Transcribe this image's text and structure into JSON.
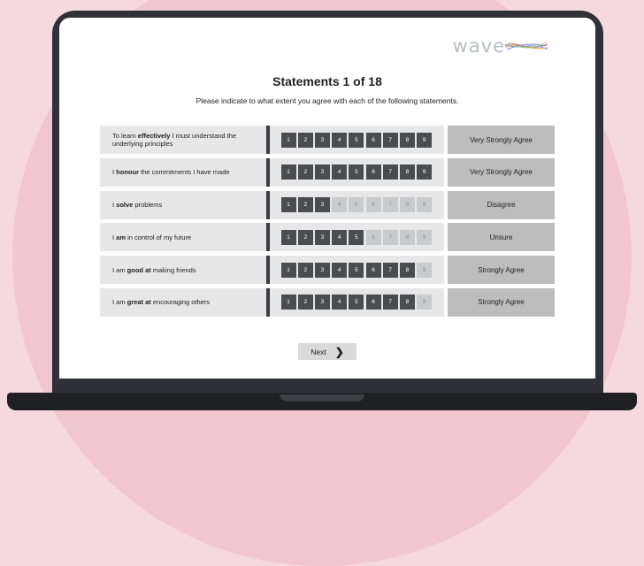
{
  "brand": {
    "logo_text": "wave"
  },
  "header": {
    "title": "Statements 1 of 18",
    "subtitle": "Please indicate to what extent you agree with each of the following statements."
  },
  "scale": {
    "labels": [
      "1",
      "2",
      "3",
      "4",
      "5",
      "6",
      "7",
      "8",
      "9"
    ]
  },
  "statements": [
    {
      "segments": [
        {
          "t": "To learn ",
          "b": false
        },
        {
          "t": "effectively",
          "b": true
        },
        {
          "t": " I must understand the underlying principles",
          "b": false
        }
      ],
      "selected": 9,
      "answer": "Very Strongly Agree"
    },
    {
      "segments": [
        {
          "t": "I ",
          "b": false
        },
        {
          "t": "honour",
          "b": true
        },
        {
          "t": " the commitments I have made",
          "b": false
        }
      ],
      "selected": 9,
      "answer": "Very Strongly Agree"
    },
    {
      "segments": [
        {
          "t": "I ",
          "b": false
        },
        {
          "t": "solve",
          "b": true
        },
        {
          "t": " problems",
          "b": false
        }
      ],
      "selected": 3,
      "answer": "Disagree"
    },
    {
      "segments": [
        {
          "t": "I ",
          "b": false
        },
        {
          "t": "am",
          "b": true
        },
        {
          "t": " in control of my future",
          "b": false
        }
      ],
      "selected": 5,
      "answer": "Unsure"
    },
    {
      "segments": [
        {
          "t": "I am ",
          "b": false
        },
        {
          "t": "good at",
          "b": true
        },
        {
          "t": " making friends",
          "b": false
        }
      ],
      "selected": 8,
      "answer": "Strongly Agree"
    },
    {
      "segments": [
        {
          "t": "I am ",
          "b": false
        },
        {
          "t": "great at",
          "b": true
        },
        {
          "t": " encouraging others",
          "b": false
        }
      ],
      "selected": 8,
      "answer": "Strongly Agree"
    }
  ],
  "footer": {
    "next_label": "Next",
    "next_icon": "chevron-right-icon"
  },
  "colors": {
    "selected": "#4a4c50",
    "unselected": "#c9cacc",
    "answer_bg": "#bdbdbd",
    "row_bg": "#e7e7e7"
  }
}
